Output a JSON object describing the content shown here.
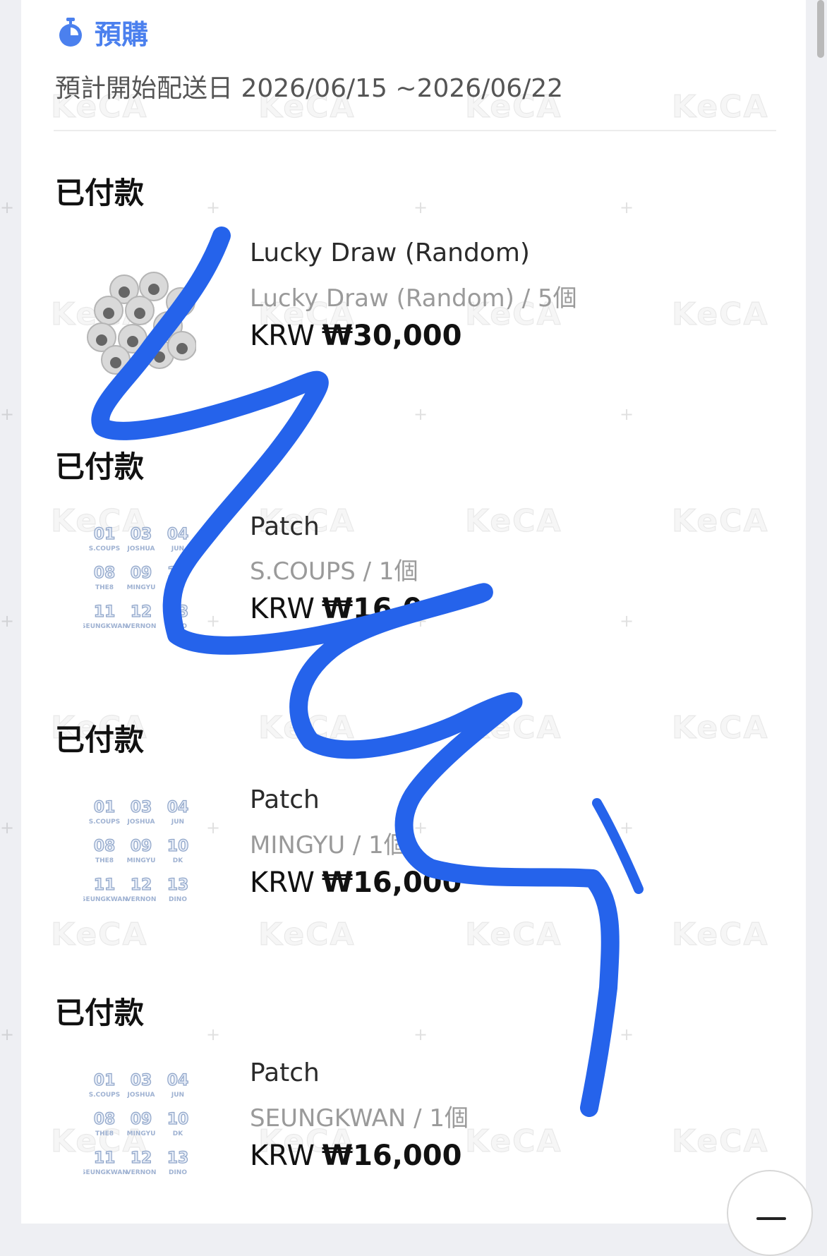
{
  "header": {
    "title": "預購",
    "icon": "timer-icon",
    "accent_color": "#4b80ee",
    "ship_date_label": "預計開始配送日",
    "ship_date_range": "2026/06/15 ~2026/06/22"
  },
  "watermark": "KeCA",
  "orders": [
    {
      "status": "已付款",
      "name": "Lucky Draw (Random)",
      "option": "Lucky Draw (Random) / 5個",
      "currency": "KRW",
      "price": "₩30,000",
      "thumbnail": "photo-badges-image"
    },
    {
      "status": "已付款",
      "name": "Patch",
      "option": "S.COUPS / 1個",
      "currency": "KRW",
      "price": "₩16,0",
      "thumbnail": "patch-number-grid-image"
    },
    {
      "status": "已付款",
      "name": "Patch",
      "option": "MINGYU / 1個",
      "currency": "KRW",
      "price": "₩16,000",
      "thumbnail": "patch-number-grid-image"
    },
    {
      "status": "已付款",
      "name": "Patch",
      "option": "SEUNGKWAN / 1個",
      "currency": "KRW",
      "price": "₩16,000",
      "thumbnail": "patch-number-grid-image"
    }
  ],
  "patch_grid": {
    "numbers": [
      "01",
      "03",
      "04",
      "08",
      "09",
      "10",
      "11",
      "12",
      "13"
    ],
    "names": [
      "S.COUPS",
      "JOSHUA",
      "JUN",
      "THE8",
      "MINGYU",
      "DK",
      "SEUNGKWAN",
      "VERNON",
      "DINO"
    ]
  },
  "scribble_color": "#2563eb",
  "fab_icon": "minus-icon"
}
